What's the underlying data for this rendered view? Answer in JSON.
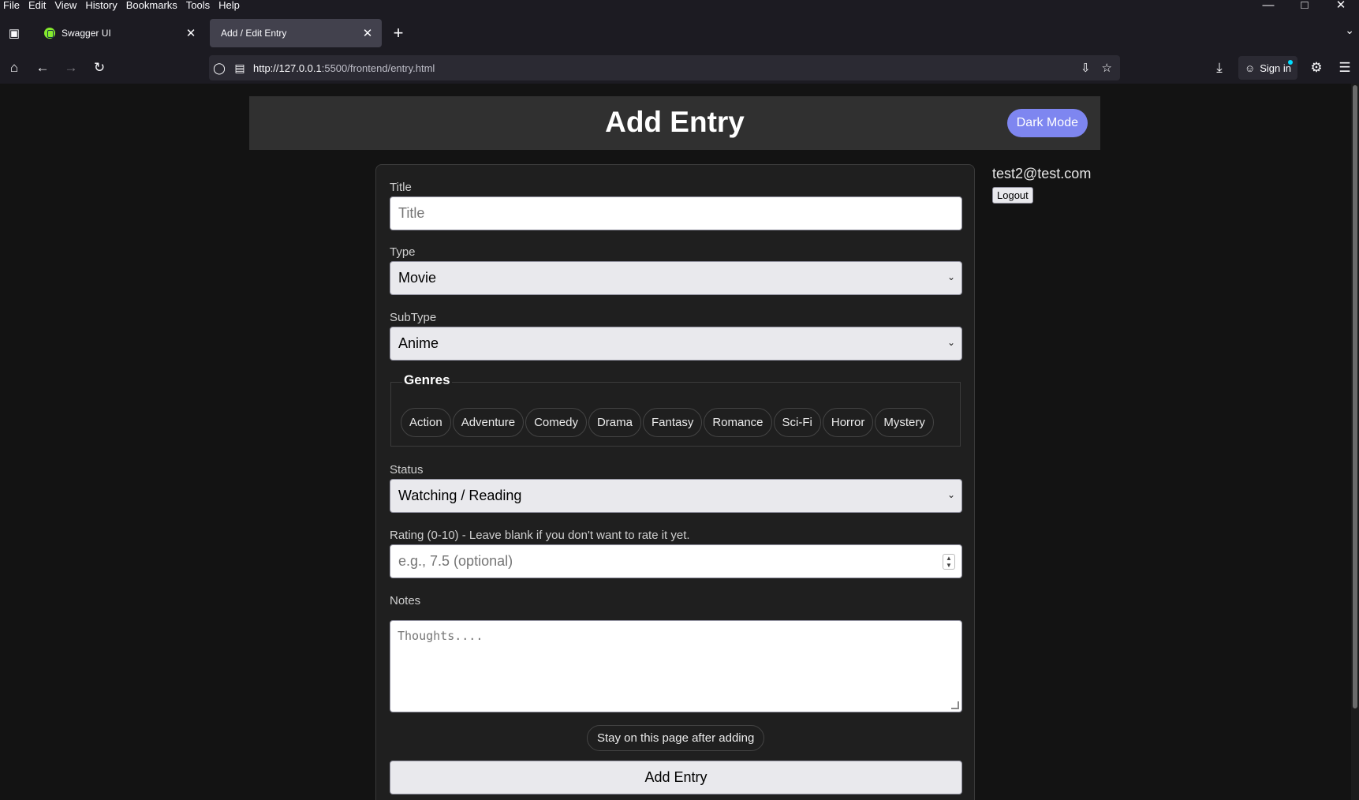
{
  "menubar": {
    "items": [
      "File",
      "Edit",
      "View",
      "History",
      "Bookmarks",
      "Tools",
      "Help"
    ]
  },
  "tabs": [
    {
      "title": "Swagger UI",
      "active": false
    },
    {
      "title": "Add / Edit Entry",
      "active": true
    }
  ],
  "navbar": {
    "url_host": "http://127.0.0.1",
    "url_rest": ":5500/frontend/entry.html",
    "signin_label": "Sign in"
  },
  "page": {
    "title": "Add Entry",
    "dark_mode_label": "Dark Mode",
    "user_email": "test2@test.com",
    "logout_label": "Logout"
  },
  "form": {
    "title_label": "Title",
    "title_placeholder": "Title",
    "type_label": "Type",
    "type_value": "Movie",
    "subtype_label": "SubType",
    "subtype_value": "Anime",
    "genres_legend": "Genres",
    "genres": [
      "Action",
      "Adventure",
      "Comedy",
      "Drama",
      "Fantasy",
      "Romance",
      "Sci-Fi",
      "Horror",
      "Mystery"
    ],
    "status_label": "Status",
    "status_value": "Watching / Reading",
    "rating_label": "Rating (0-10) - Leave blank if you don't want to rate it yet.",
    "rating_placeholder": "e.g., 7.5 (optional)",
    "notes_label": "Notes",
    "notes_placeholder": "Thoughts....",
    "stay_label": "Stay on this page after adding",
    "submit_label": "Add Entry"
  },
  "colors": {
    "accent": "#7e86f0",
    "page_bg": "#131313",
    "header_bg": "#303030",
    "card_bg": "#1f1f1f"
  }
}
